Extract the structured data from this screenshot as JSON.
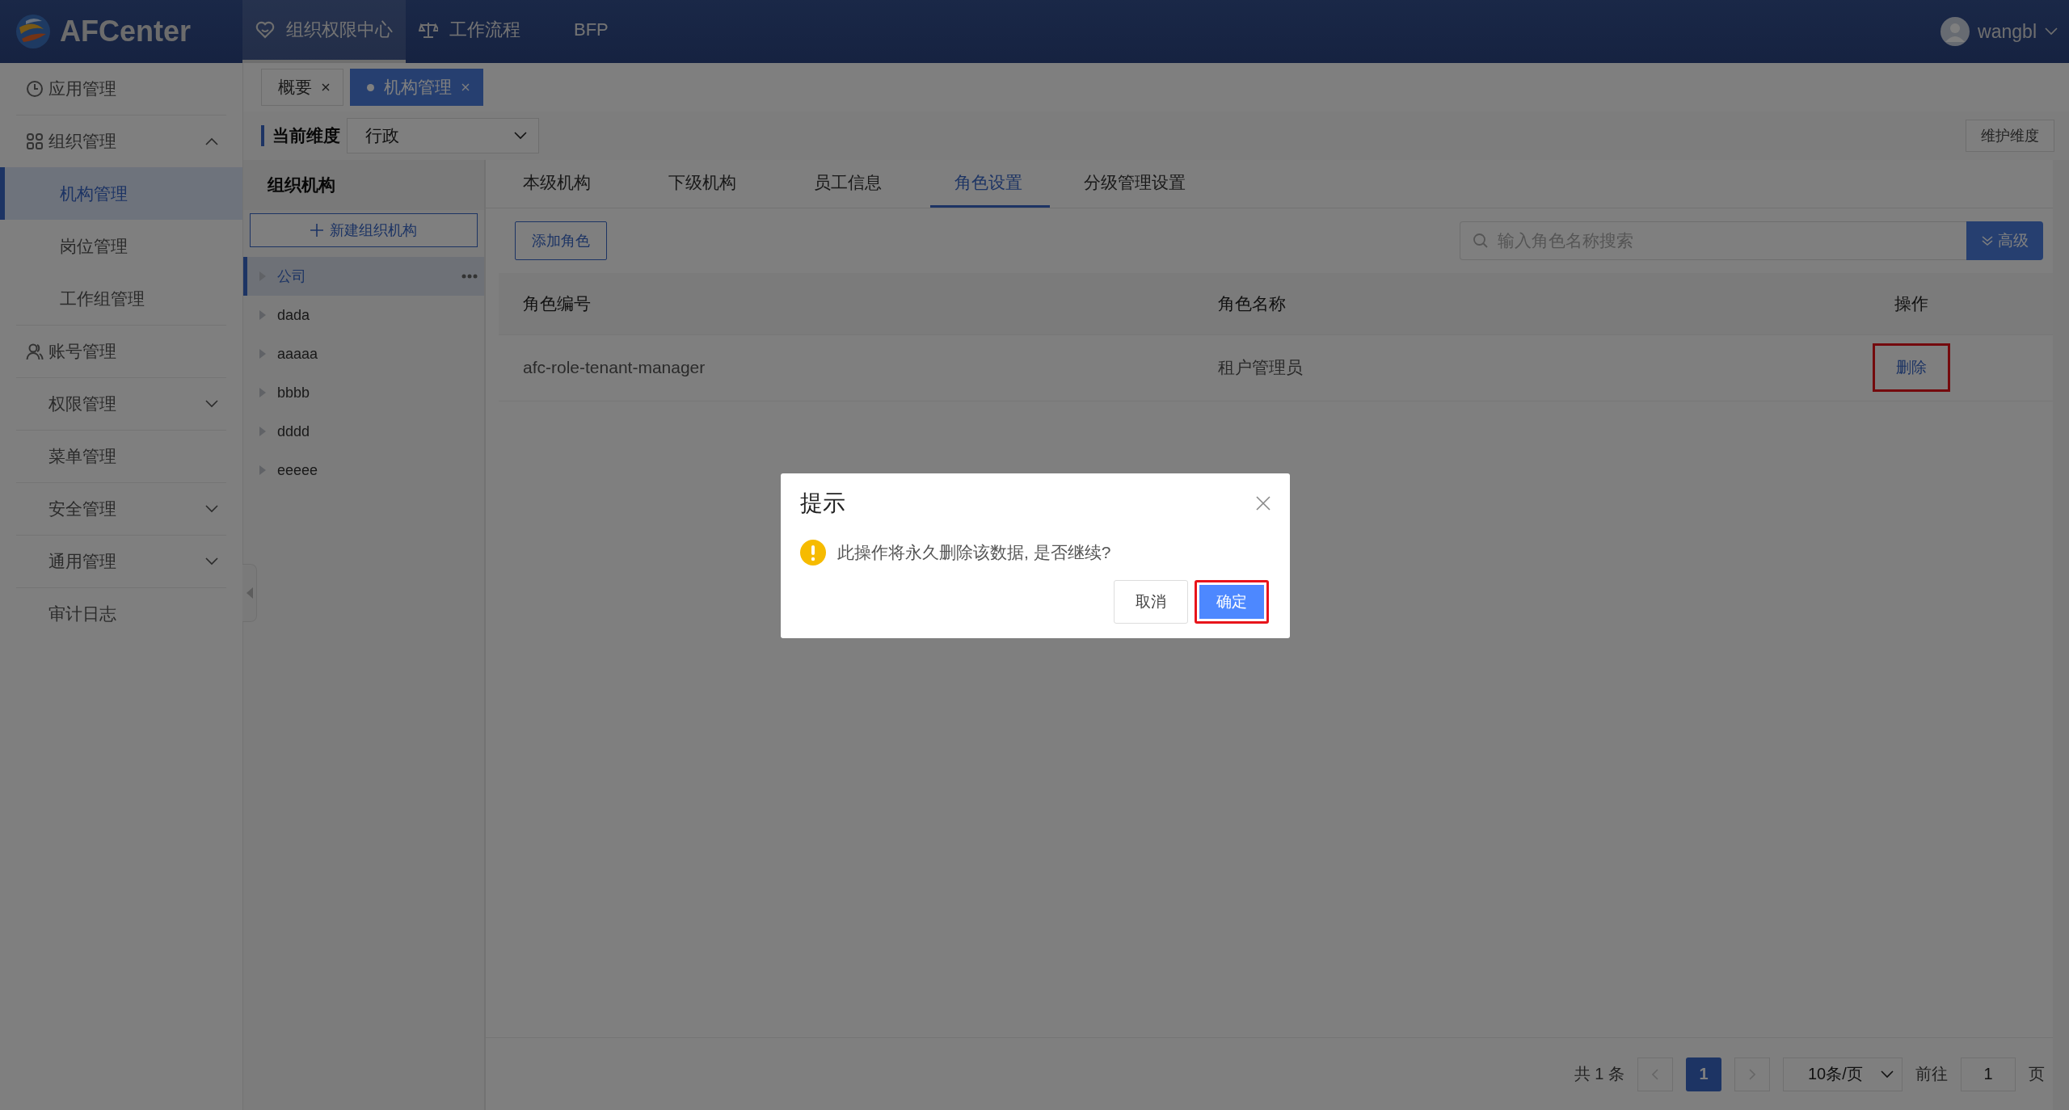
{
  "app": {
    "logo": "AFCenter",
    "nav": [
      {
        "label": "组织权限中心",
        "selected": true
      },
      {
        "label": "工作流程",
        "selected": false
      },
      {
        "label": "BFP",
        "selected": false
      }
    ],
    "user": "wangbl"
  },
  "sidebar": {
    "items": [
      {
        "label": "应用管理",
        "kind": "link",
        "selected": false
      },
      {
        "label": "组织管理",
        "kind": "group",
        "expanded": true,
        "children": [
          {
            "label": "机构管理",
            "selected": true
          },
          {
            "label": "岗位管理",
            "selected": false
          },
          {
            "label": "工作组管理",
            "selected": false
          }
        ]
      },
      {
        "label": "账号管理",
        "kind": "link",
        "selected": false
      },
      {
        "label": "权限管理",
        "kind": "group",
        "expanded": false
      },
      {
        "label": "菜单管理",
        "kind": "link",
        "selected": false
      },
      {
        "label": "安全管理",
        "kind": "group",
        "expanded": false
      },
      {
        "label": "通用管理",
        "kind": "group",
        "expanded": false
      },
      {
        "label": "审计日志",
        "kind": "link",
        "selected": false
      }
    ]
  },
  "page_tabs": [
    {
      "label": "概要",
      "selected": false
    },
    {
      "label": "机构管理",
      "selected": true
    }
  ],
  "dimension": {
    "label": "当前维度",
    "value": "行政",
    "maintain_button": "维护维度"
  },
  "org_panel": {
    "title": "组织机构",
    "new_button": "新建组织机构",
    "tree": [
      {
        "label": "公司",
        "selected": true,
        "expanded": false
      },
      {
        "label": "dada",
        "selected": false,
        "expanded": false
      },
      {
        "label": "aaaaa",
        "selected": false,
        "expanded": false
      },
      {
        "label": "bbbb",
        "selected": false,
        "expanded": false
      },
      {
        "label": "dddd",
        "selected": false,
        "expanded": false
      },
      {
        "label": "eeeee",
        "selected": false,
        "expanded": false
      }
    ]
  },
  "detail_tabs": [
    {
      "label": "本级机构",
      "selected": false
    },
    {
      "label": "下级机构",
      "selected": false
    },
    {
      "label": "员工信息",
      "selected": false
    },
    {
      "label": "角色设置",
      "selected": true
    },
    {
      "label": "分级管理设置",
      "selected": false
    }
  ],
  "toolbar": {
    "add_button": "添加角色",
    "search": {
      "placeholder": "输入角色名称搜索"
    },
    "advanced_button": "高级"
  },
  "table": {
    "columns": [
      "角色编号",
      "角色名称",
      "操作"
    ],
    "rows": [
      {
        "cells": [
          "afc-role-tenant-manager",
          "租户管理员"
        ],
        "action": "删除",
        "highlighted": true
      }
    ]
  },
  "pagination": {
    "total": "共 1 条",
    "pages": [
      {
        "label": "1",
        "selected": true
      }
    ],
    "page_size": "10条/页",
    "goto_label": "前往",
    "goto_value": "1",
    "page_suffix": "页"
  },
  "dialog": {
    "title": "提示",
    "message": "此操作将永久删除该数据, 是否继续?",
    "buttons": [
      {
        "label": "取消",
        "kind": "default",
        "highlighted": false
      },
      {
        "label": "确定",
        "kind": "primary",
        "highlighted": true
      }
    ]
  }
}
